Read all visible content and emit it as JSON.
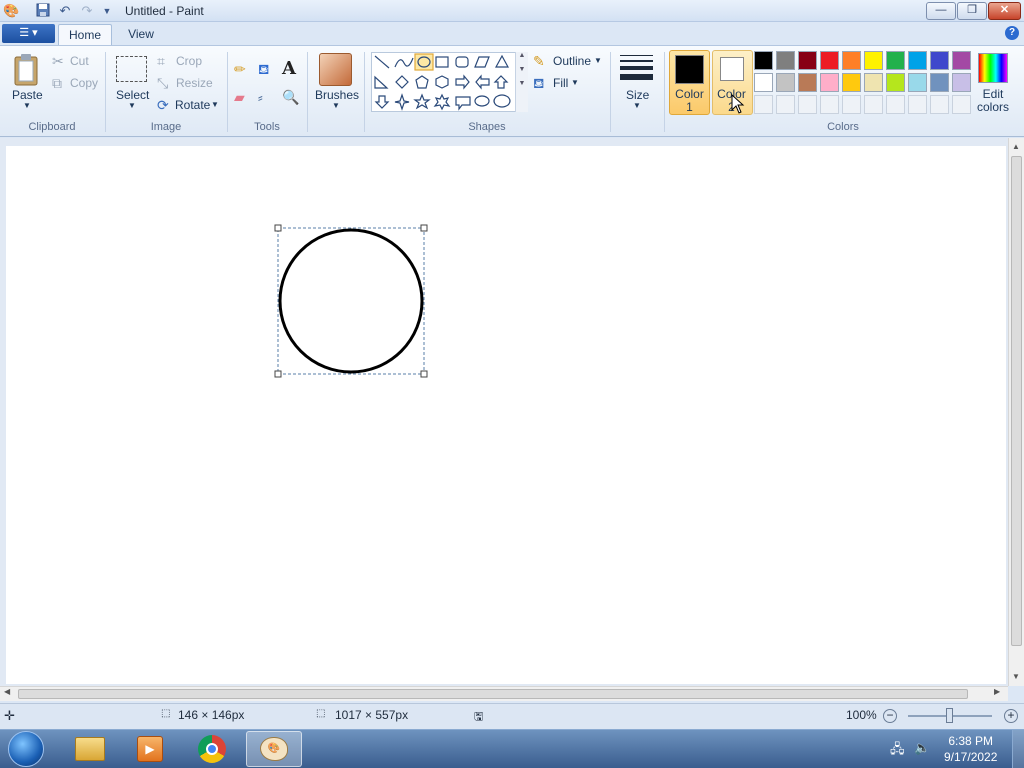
{
  "window": {
    "title": "Untitled - Paint",
    "minimize": "—",
    "restore": "❐",
    "close": "✕"
  },
  "quick_access": {
    "save_icon": "save-icon",
    "undo_icon": "undo-icon",
    "redo_icon": "redo-icon",
    "customize_icon": "chevron-down-icon"
  },
  "tabs": {
    "home": "Home",
    "view": "View"
  },
  "help": "?",
  "clipboard": {
    "paste": "Paste",
    "cut": "Cut",
    "copy": "Copy",
    "group": "Clipboard"
  },
  "image": {
    "select": "Select",
    "crop": "Crop",
    "resize": "Resize",
    "rotate": "Rotate",
    "group": "Image"
  },
  "tools": {
    "group": "Tools"
  },
  "brushes": {
    "label": "Brushes"
  },
  "shapes": {
    "outline": "Outline",
    "fill": "Fill",
    "group": "Shapes"
  },
  "size": {
    "label": "Size"
  },
  "colors": {
    "color1": "Color\n1",
    "color2": "Color\n2",
    "edit": "Edit\ncolors",
    "group": "Colors",
    "color1_value": "#000000",
    "color2_value": "#ffffff",
    "row1": [
      "#000000",
      "#7f7f7f",
      "#880015",
      "#ed1c24",
      "#ff7f27",
      "#fff200",
      "#22b14c",
      "#00a2e8",
      "#3f48cc",
      "#a349a4"
    ],
    "row2": [
      "#ffffff",
      "#c3c3c3",
      "#b97a57",
      "#ffaec9",
      "#ffc90e",
      "#efe4b0",
      "#b5e61d",
      "#99d9ea",
      "#7092be",
      "#c8bfe7"
    ]
  },
  "status": {
    "selection_size": "146 × 146px",
    "canvas_size": "1017 × 557px",
    "zoom": "100%"
  },
  "taskbar": {
    "time": "6:38 PM",
    "date": "9/17/2022"
  }
}
